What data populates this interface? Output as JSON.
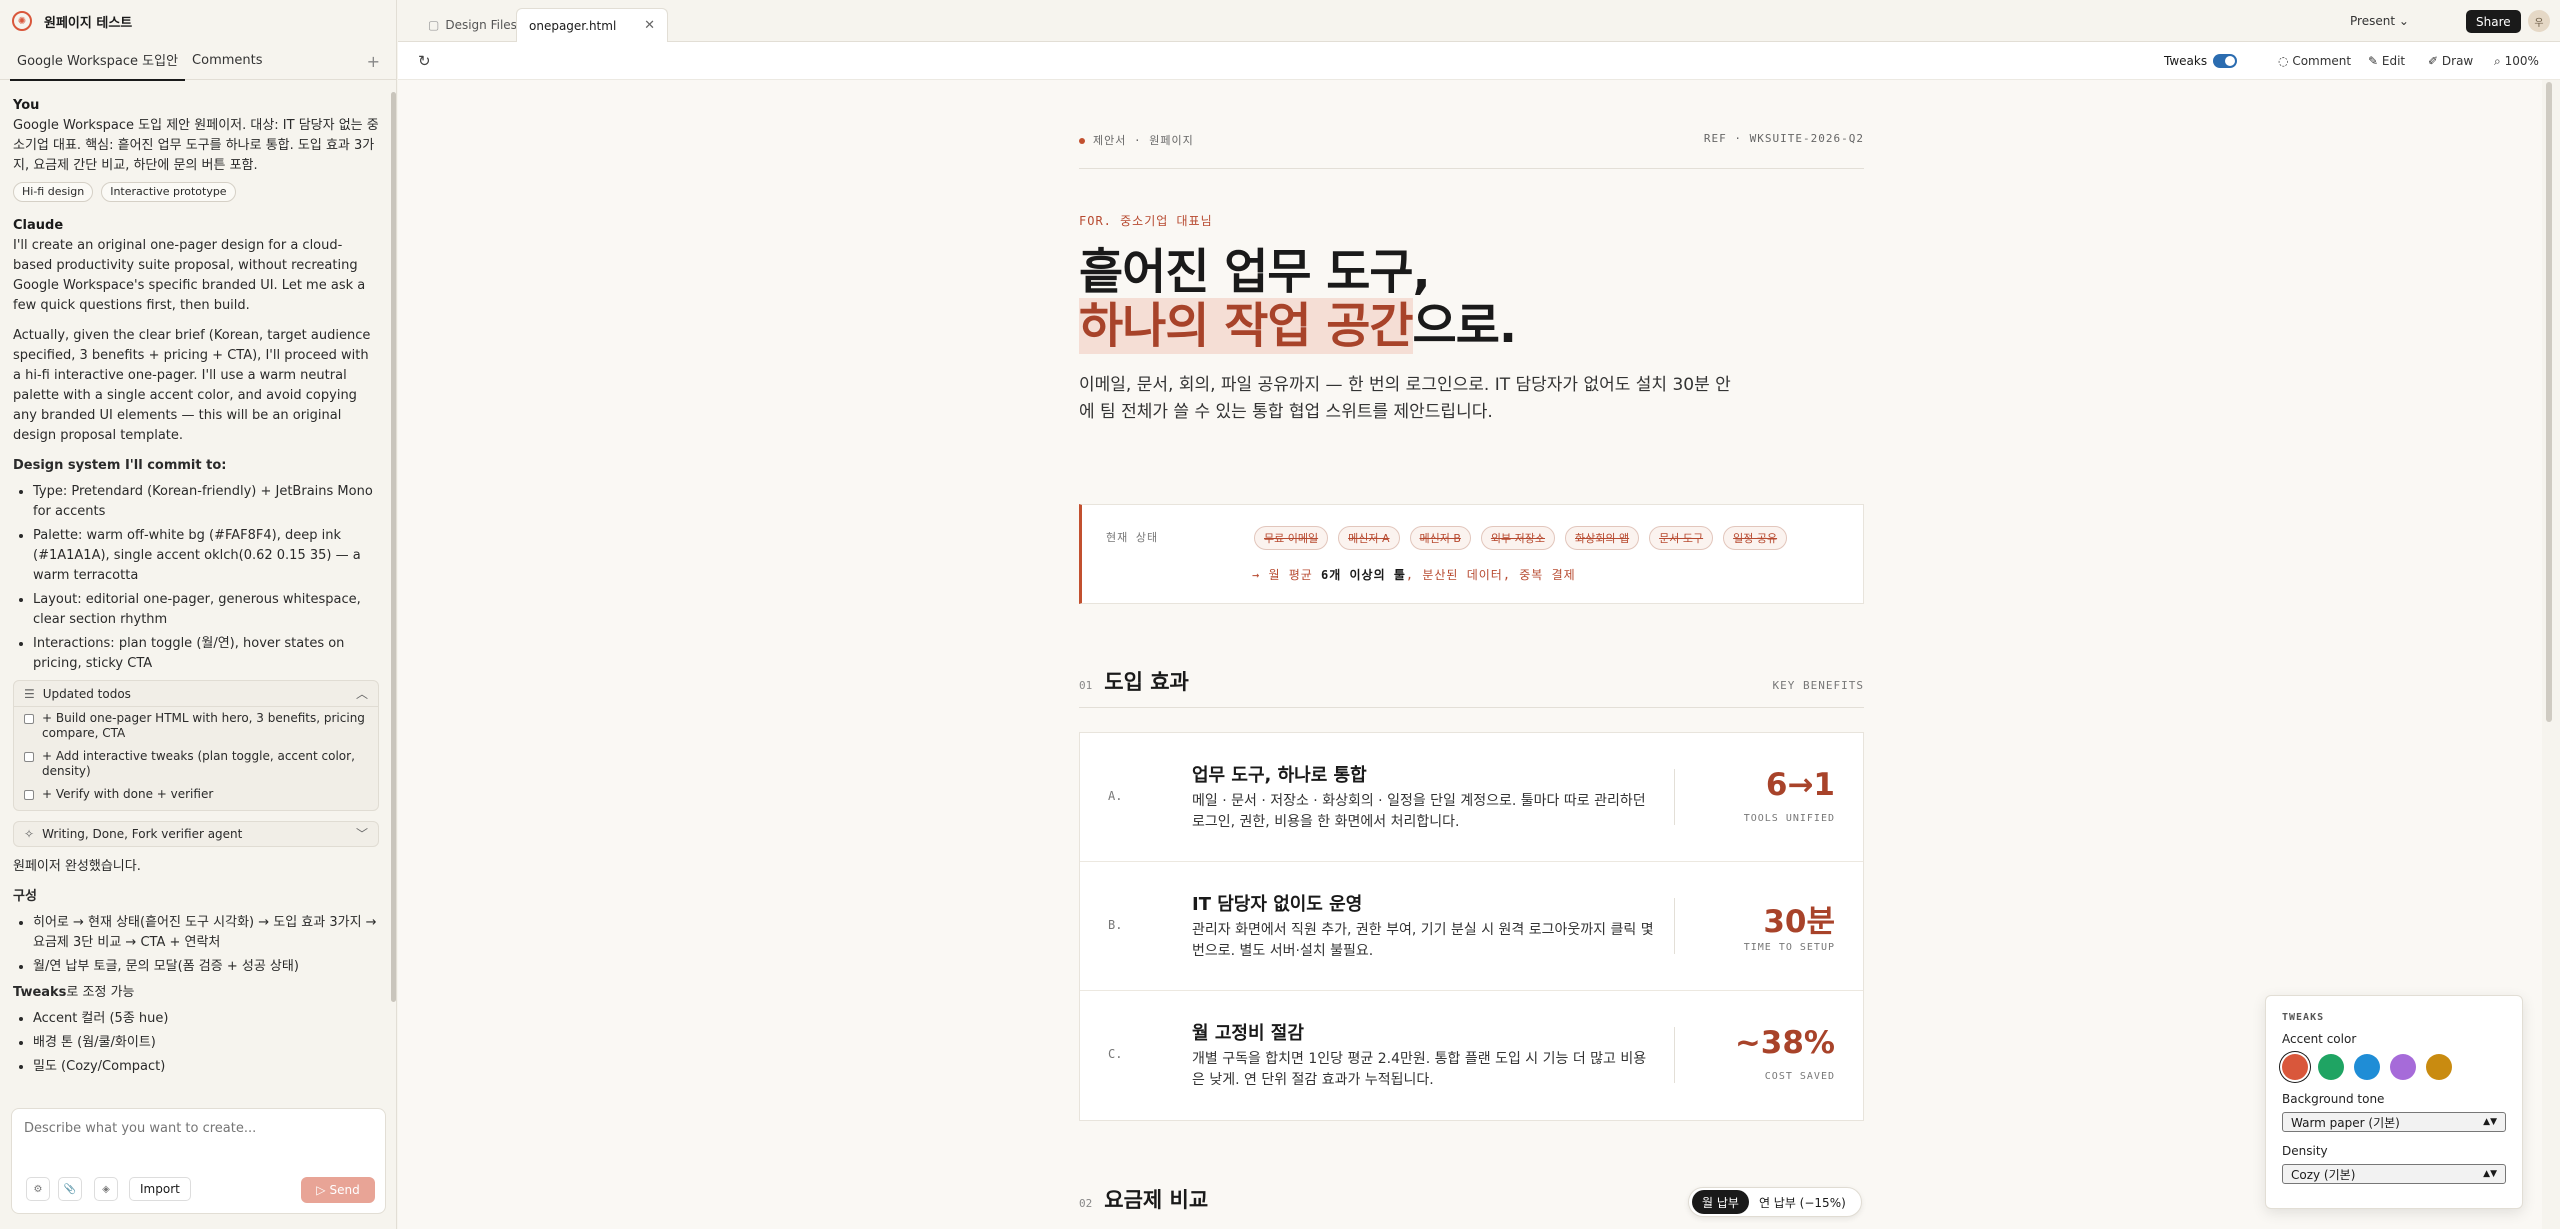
{
  "project": {
    "title": "원페이지 테스트"
  },
  "left_tabs": [
    {
      "label": "Google Workspace 도입안"
    },
    {
      "label": "Comments"
    }
  ],
  "chat": {
    "user_role": "You",
    "user_message": "Google Workspace 도입 제안 원페이저. 대상: IT 담당자 없는 중소기업 대표. 핵심: 흩어진 업무 도구를 하나로 통합. 도입 효과 3가지, 요금제 간단 비교, 하단에 문의 버튼 포함.",
    "chips": [
      "Hi-fi design",
      "Interactive prototype"
    ],
    "assistant_role": "Claude",
    "assistant_p1": "I'll create an original one-pager design for a cloud-based productivity suite proposal, without recreating Google Workspace's specific branded UI. Let me ask a few quick questions first, then build.",
    "assistant_p2": "Actually, given the clear brief (Korean, target audience specified, 3 benefits + pricing + CTA), I'll proceed with a hi-fi interactive one-pager. I'll use a warm neutral palette with a single accent color, and avoid copying any branded UI elements — this will be an original design proposal template.",
    "design_heading": "Design system I'll commit to:",
    "design_items": [
      "Type: Pretendard (Korean-friendly) + JetBrains Mono for accents",
      "Palette: warm off-white bg (#FAF8F4), deep ink (#1A1A1A), single accent oklch(0.62 0.15 35) — a warm terracotta",
      "Layout: editorial one-pager, generous whitespace, clear section rhythm",
      "Interactions: plan toggle (월/연), hover states on pricing, sticky CTA"
    ],
    "todos_title": "Updated todos",
    "todos": [
      "+ Build one-pager HTML with hero, 3 benefits, pricing compare, CTA",
      "+ Add interactive tweaks (plan toggle, accent color, density)",
      "+ Verify with done + verifier"
    ],
    "agent_label": "Writing, Done, Fork verifier agent",
    "done_text": "원페이저 완성했습니다.",
    "structure_heading": "구성",
    "structure_items": [
      "히어로 → 현재 상태(흩어진 도구 시각화) → 도입 효과 3가지 → 요금제 3단 비교 → CTA + 연락처",
      "월/연 납부 토글, 문의 모달(폼 검증 + 성공 상태)"
    ],
    "tweaks_heading_bold": "Tweaks",
    "tweaks_heading_rest": "로 조정 가능",
    "tweaks_items": [
      "Accent 컬러 (5종 hue)",
      "배경 톤 (웜/쿨/화이트)",
      "밀도 (Cozy/Compact)"
    ]
  },
  "composer": {
    "placeholder": "Describe what you want to create...",
    "import_label": "Import",
    "send_label": "Send"
  },
  "topbar": {
    "tab_design": "Design Files",
    "tab_active": "onepager.html",
    "present_label": "Present",
    "share_label": "Share",
    "avatar_initial": "우"
  },
  "toolbar": {
    "tweaks_label": "Tweaks",
    "comment_label": "Comment",
    "edit_label": "Edit",
    "draw_label": "Draw",
    "zoom_label": "100%"
  },
  "doc": {
    "kicker": "제안서 · 원페이지",
    "ref": "REF · WKSUITE-2026-Q2",
    "for_line": "FOR. 중소기업 대표님",
    "hero_line1": "흩어진 업무 도구,",
    "hero_accent": "하나의 작업 공간",
    "hero_rest": "으로.",
    "subtitle": "이메일, 문서, 회의, 파일 공유까지 — 한 번의 로그인으로. IT 담당자가 없어도 설치 30분 안에 팀 전체가 쓸 수 있는 통합 협업 스위트를 제안드립니다.",
    "status_label": "현재 상태",
    "status_tags": [
      "무료 이메일",
      "메신저 A",
      "메신저 B",
      "외부 저장소",
      "화상회의 앱",
      "문서 도구",
      "일정 공유"
    ],
    "status_prefix": "→ 월 평균 ",
    "status_strong": "6개 이상의 툴",
    "status_suffix": ", 분산된 데이터, 중복 결제",
    "sec1_num": "01",
    "sec1_title": "도입 효과",
    "sec1_en": "KEY BENEFITS",
    "benefits": [
      {
        "letter": "A.",
        "title": "업무 도구, 하나로 통합",
        "desc": "메일 · 문서 · 저장소 · 화상회의 · 일정을 단일 계정으로. 툴마다 따로 관리하던 로그인, 권한, 비용을 한 화면에서 처리합니다.",
        "metric": "6→1",
        "caption": "TOOLS UNIFIED"
      },
      {
        "letter": "B.",
        "title": "IT 담당자 없이도 운영",
        "desc": "관리자 화면에서 직원 추가, 권한 부여, 기기 분실 시 원격 로그아웃까지 클릭 몇 번으로. 별도 서버·설치 불필요.",
        "metric": "30분",
        "caption": "TIME TO SETUP"
      },
      {
        "letter": "C.",
        "title": "월 고정비 절감",
        "desc": "개별 구독을 합치면 1인당 평균 2.4만원. 통합 플랜 도입 시 기능 더 많고 비용은 낮게. 연 단위 절감 효과가 누적됩니다.",
        "metric": "~38%",
        "caption": "COST SAVED"
      }
    ],
    "sec2_num": "02",
    "sec2_title": "요금제 비교"
  },
  "plan_toggle": {
    "monthly": "월 납부",
    "yearly": "연 납부 (−15%)"
  },
  "tweaks_panel": {
    "title": "TWEAKS",
    "accent_label": "Accent color",
    "accent_colors": [
      "#D9573B",
      "#1FA463",
      "#1F8DD6",
      "#A66BD9",
      "#C98B10"
    ],
    "bg_label": "Background tone",
    "bg_value": "Warm paper (기본)",
    "density_label": "Density",
    "density_value": "Cozy (기본)"
  }
}
